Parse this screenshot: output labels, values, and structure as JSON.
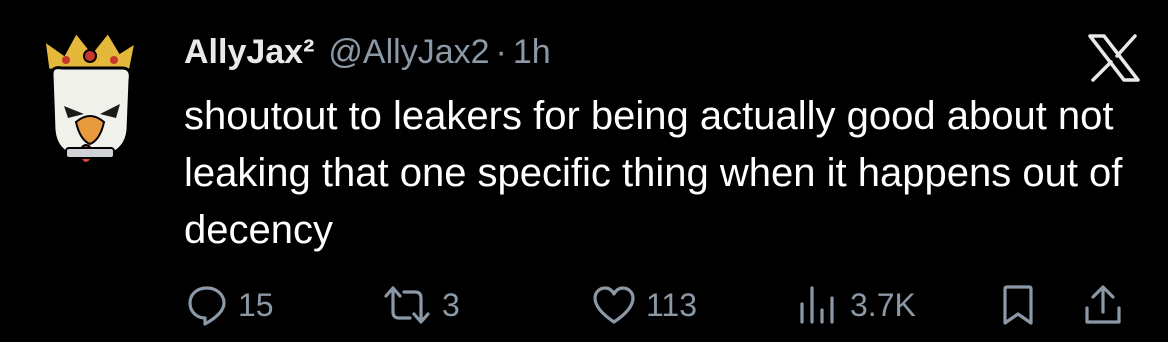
{
  "author": {
    "name": "AllyJax²",
    "handle": "@AllyJax2",
    "separator": "·",
    "time": "1h"
  },
  "tweet": {
    "text": "shoutout to leakers for being actually good about not leaking that one specific thing when it happens out of decency"
  },
  "actions": {
    "replies": "15",
    "reposts": "3",
    "likes": "113",
    "views": "3.7K"
  },
  "colors": {
    "background": "#000000",
    "text": "#e7e9ea",
    "muted": "#8b98a5"
  },
  "icons": [
    "x-logo-icon",
    "reply-icon",
    "repost-icon",
    "like-icon",
    "views-icon",
    "bookmark-icon",
    "share-icon"
  ]
}
